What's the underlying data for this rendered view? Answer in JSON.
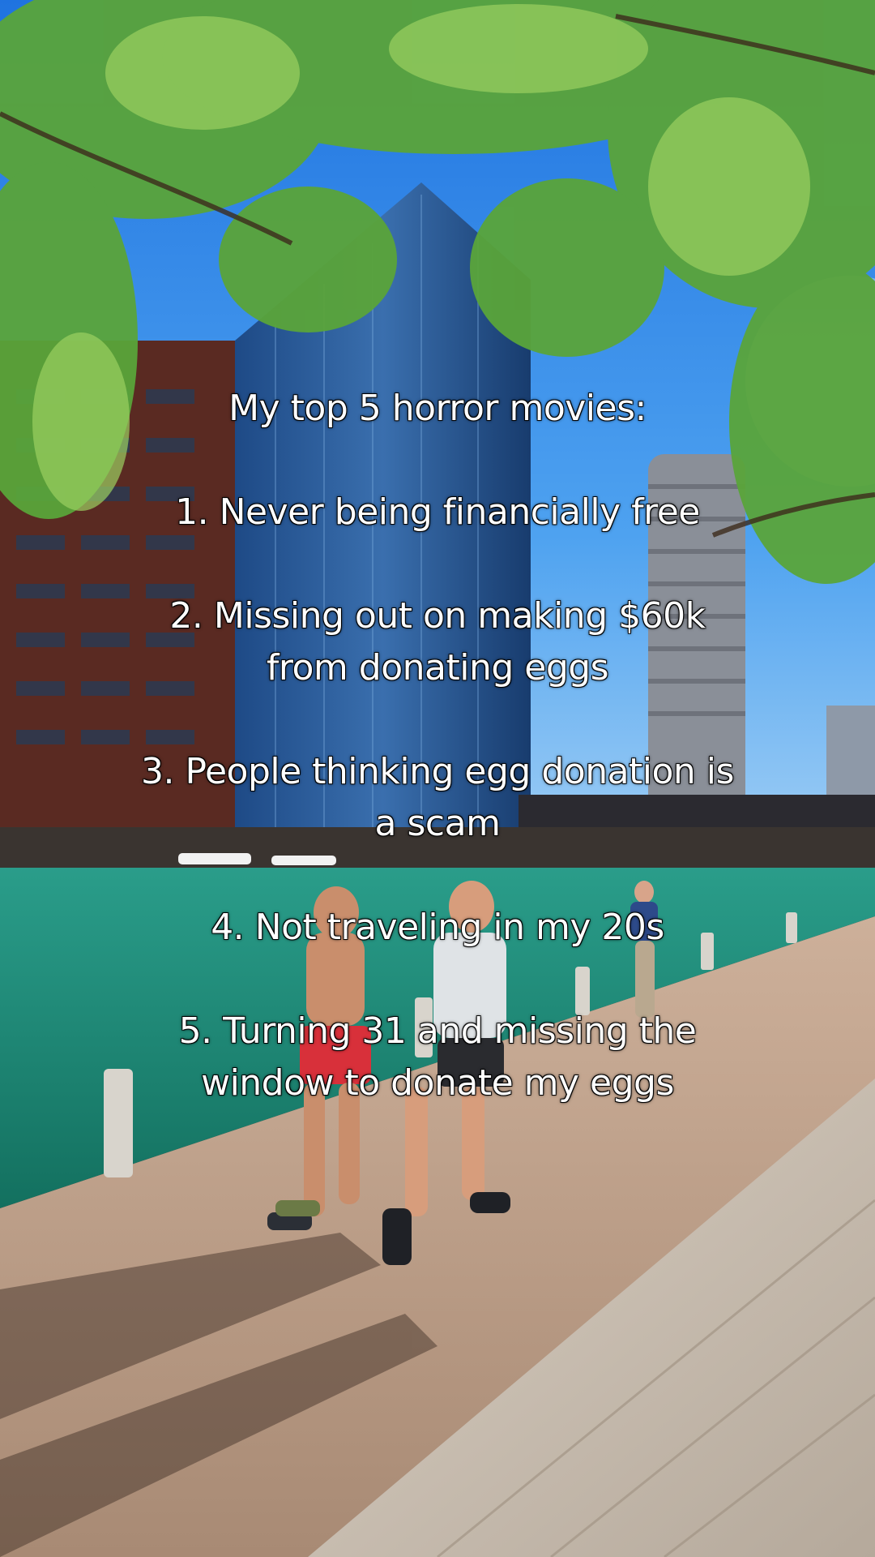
{
  "overlay_text": {
    "title": "My top 5 horror movies:",
    "items": [
      {
        "line1": "1. Never being financially free",
        "line2": ""
      },
      {
        "line1": "2. Missing out on making $60k",
        "line2": "from donating eggs"
      },
      {
        "line1": "3. People thinking egg donation is",
        "line2": "a scam"
      },
      {
        "line1": "4. Not traveling in my 20s",
        "line2": ""
      },
      {
        "line1": "5. Turning 31 and missing the",
        "line2": "window to donate my eggs"
      }
    ]
  },
  "colors": {
    "sky": "#2f86e6",
    "foliage": "#5aa43a",
    "river": "#1f8f7a",
    "walkway": "#c7a58d",
    "text": "#ffffff"
  }
}
